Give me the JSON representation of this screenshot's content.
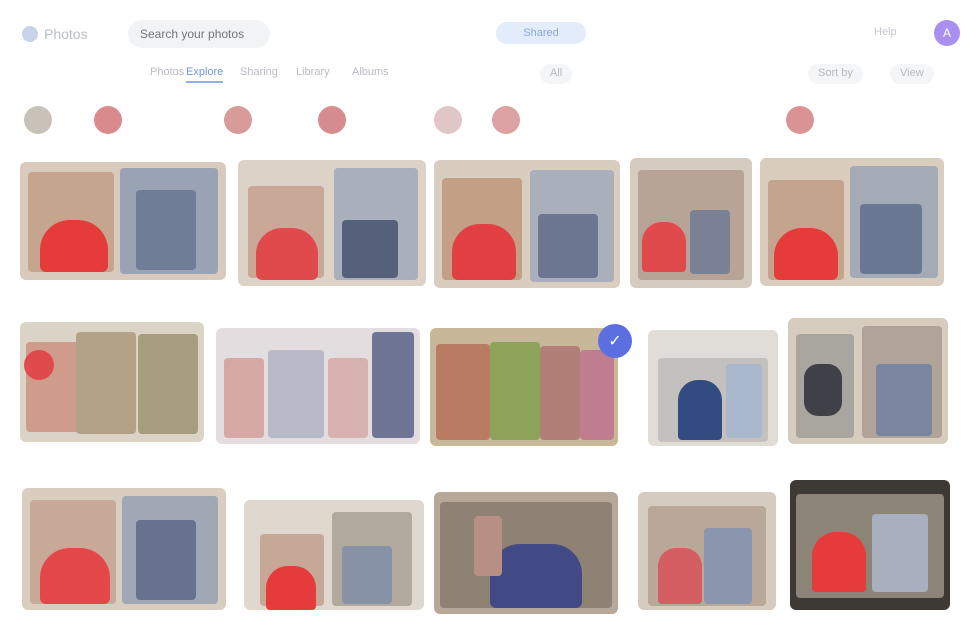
{
  "header": {
    "logo_text": "Photos",
    "search_placeholder": "Search your photos",
    "center_label": "Shared",
    "right_text": "Help",
    "avatar_initial": "A"
  },
  "tabs": [
    {
      "label": "Photos",
      "active": true
    },
    {
      "label": "Explore",
      "active": false
    },
    {
      "label": "Sharing",
      "active": false
    },
    {
      "label": "Library",
      "active": false
    },
    {
      "label": "Albums",
      "active": false
    }
  ],
  "toolbar": {
    "middle_label": "All",
    "sort_label": "Sort by",
    "view_label": "View"
  },
  "badges": [
    {
      "label": "",
      "color": "#c9c2b8"
    },
    {
      "label": "",
      "color": "#d88a8c"
    },
    {
      "label": "",
      "color": "#d99a9a"
    },
    {
      "label": "",
      "color": "#d78d8f"
    },
    {
      "label": "",
      "color": "#e0c6c8"
    },
    {
      "label": "",
      "color": "#dda2a4"
    },
    {
      "label": "",
      "color": "#d99395"
    }
  ],
  "selected_icon": "check-icon",
  "colors": {
    "accent": "#6f95dd",
    "selected": "#5c6fe0",
    "avatar": "#a98ff0"
  }
}
